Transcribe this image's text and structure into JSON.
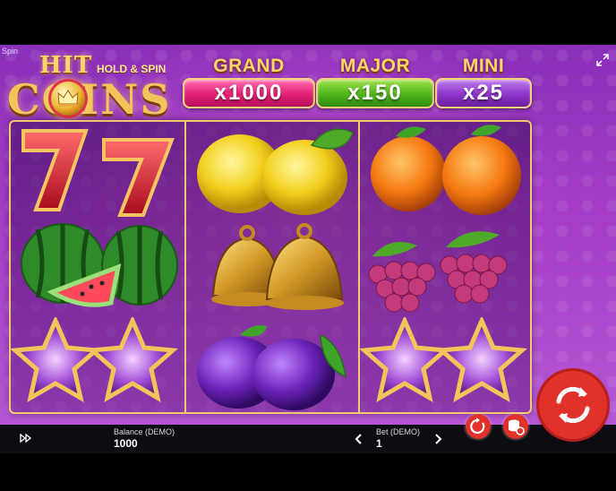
{
  "top_label": "Spin",
  "logo": {
    "line1": "HIT",
    "tagline": "HOLD & SPIN",
    "line2": "COINS"
  },
  "jackpots": [
    {
      "title": "GRAND",
      "value": "x1000",
      "color": "#e31f74"
    },
    {
      "title": "MAJOR",
      "value": "x150",
      "color": "#4fb51d"
    },
    {
      "title": "MINI",
      "value": "x25",
      "color": "#8d35c9"
    }
  ],
  "reels": [
    [
      "seven-icon",
      "watermelon-icon",
      "star-icon"
    ],
    [
      "lemon-icon",
      "bell-icon",
      "plum-icon"
    ],
    [
      "orange-icon",
      "grapes-icon",
      "star-icon"
    ]
  ],
  "bottom": {
    "balance_label": "Balance (DEMO)",
    "balance_value": "1000",
    "bet_label": "Bet (DEMO)",
    "bet_value": "1"
  },
  "colors": {
    "accent": "#e0322a",
    "frame": "#f2c870",
    "background": "#a33cc7"
  }
}
